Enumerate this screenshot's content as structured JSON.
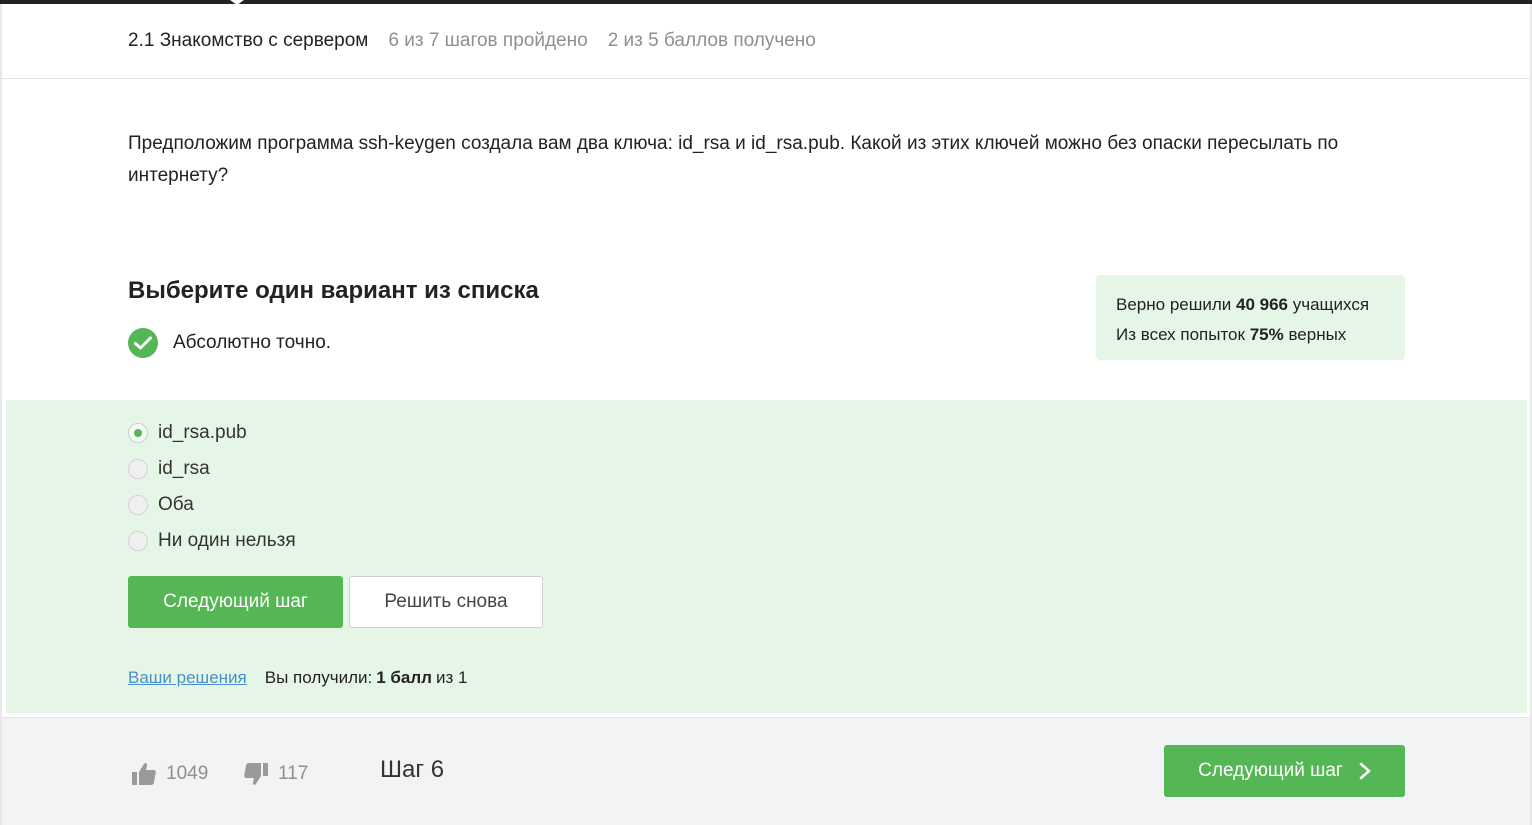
{
  "header": {
    "lesson_title": "2.1 Знакомство с сервером",
    "steps_progress": "6 из 7 шагов пройдено",
    "score_progress": "2 из 5 баллов  получено"
  },
  "question": {
    "text": "Предположим программа ssh-keygen создала вам два ключа: id_rsa и id_rsa.pub. Какой из этих ключей можно без опаски пересылать по интернету?"
  },
  "quiz": {
    "title": "Выберите один вариант из списка",
    "feedback": "Абсолютно точно.",
    "options": [
      {
        "label": "id_rsa.pub",
        "selected": true
      },
      {
        "label": "id_rsa",
        "selected": false
      },
      {
        "label": "Оба",
        "selected": false
      },
      {
        "label": "Ни один нельзя",
        "selected": false
      }
    ],
    "next_button": "Следующий шаг",
    "retry_button": "Решить снова"
  },
  "stats": {
    "solved_prefix": "Верно решили",
    "solved_count": "40 966",
    "solved_suffix": "учащихся",
    "attempts_prefix": "Из всех попыток",
    "attempts_percent": "75%",
    "attempts_suffix": "верных"
  },
  "result": {
    "solutions_link": "Ваши решения",
    "received_prefix": "Вы получили:",
    "received_points": "1 балл",
    "received_suffix": "из 1"
  },
  "footer": {
    "likes": "1049",
    "dislikes": "117",
    "step_label": "Шаг 6",
    "next_button": "Следующий шаг"
  },
  "colors": {
    "accent_green": "#54b654",
    "success_bg": "#e6f6e6",
    "link_blue": "#4a90c8"
  }
}
